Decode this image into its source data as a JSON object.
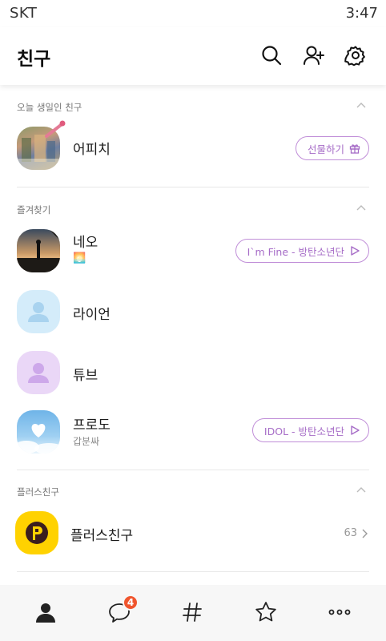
{
  "status_bar": {
    "carrier": "SKT",
    "time": "3:47"
  },
  "header": {
    "title": "친구"
  },
  "sections": {
    "birthday": {
      "label": "오늘 생일인 친구",
      "friend": {
        "name": "어피치",
        "action": "선물하기",
        "action_icon": "gift-icon"
      }
    },
    "favorites": {
      "label": "즐겨찾기",
      "friends": [
        {
          "name": "네오",
          "status_emoji": "🌅",
          "music": "I`m Fine - 방탄소년단"
        },
        {
          "name": "라이언"
        },
        {
          "name": "튜브"
        },
        {
          "name": "프로도",
          "status_message": "갑분싸",
          "music": "IDOL - 방탄소년단"
        }
      ]
    },
    "plus_friends": {
      "label": "플러스친구",
      "item": {
        "name": "플러스친구",
        "count": "63"
      }
    }
  },
  "tab_bar": {
    "tabs": [
      {
        "name": "friends",
        "icon": "person-icon",
        "active": true
      },
      {
        "name": "chats",
        "icon": "chat-bubble-icon",
        "badge": "4"
      },
      {
        "name": "hashtag",
        "icon": "hash-icon"
      },
      {
        "name": "favorites",
        "icon": "star-icon"
      },
      {
        "name": "more",
        "icon": "more-dots-icon"
      }
    ]
  },
  "colors": {
    "accent_purple": "#a66cc7",
    "badge_orange": "#f0552d",
    "plus_yellow": "#ffd200"
  }
}
